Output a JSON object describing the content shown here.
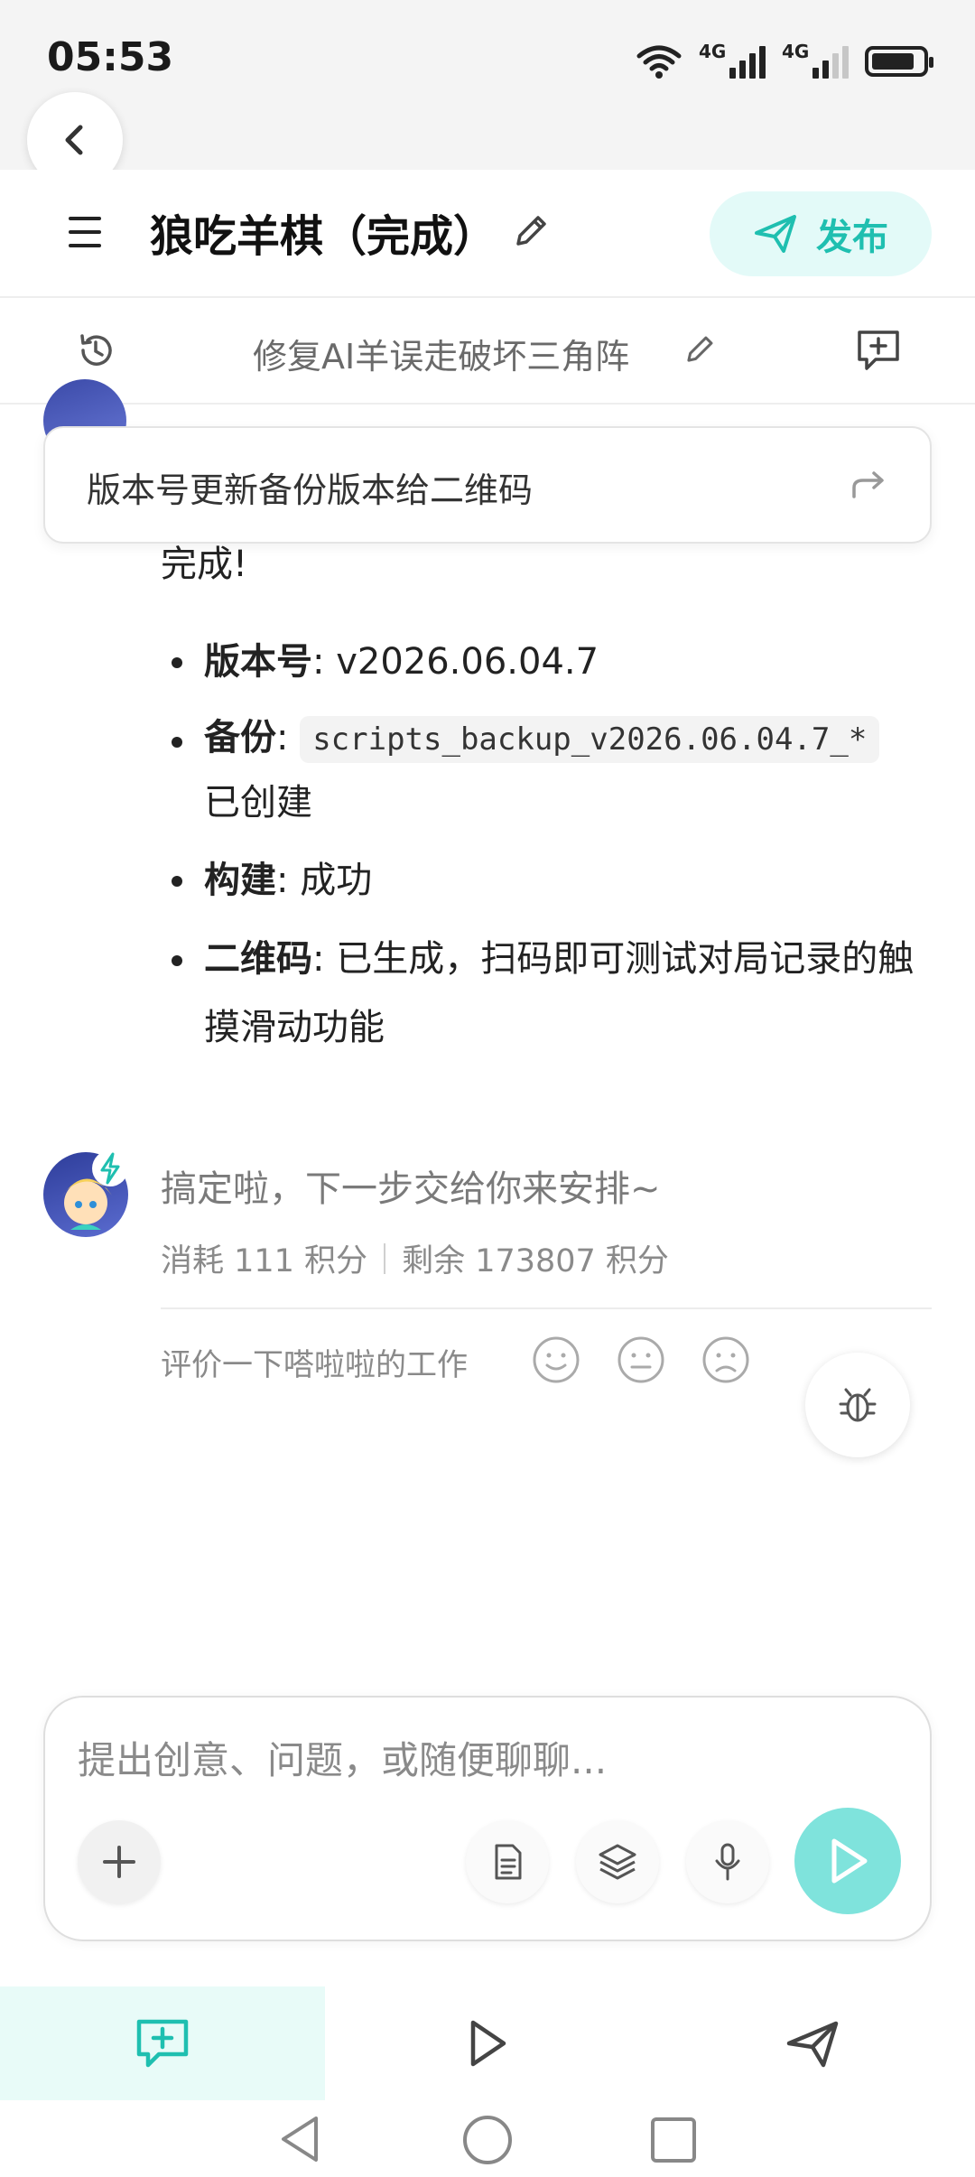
{
  "status": {
    "time": "05:53",
    "network1": "4G",
    "network2": "4G"
  },
  "header": {
    "title": "狼吃羊棋（完成）",
    "publish_label": "发布"
  },
  "subheader": {
    "title": "修复AI羊误走破坏三角阵"
  },
  "floating_card": {
    "text": "版本号更新备份版本给二维码"
  },
  "message": {
    "done": "完成!",
    "bullets": [
      {
        "key": "版本号",
        "value": ": v2026.06.04.7"
      },
      {
        "key": "备份",
        "sep": ": ",
        "code": "scripts_backup_v2026.06.04.7_*",
        "tail": "已创建"
      },
      {
        "key": "构建",
        "value": ": 成功"
      },
      {
        "key": "二维码",
        "value": ": 已生成，扫码即可测试对局记录的触摸滑动功能"
      }
    ]
  },
  "reply": {
    "text": "搞定啦，下一步交给你来安排~",
    "cost": "消耗 111 积分",
    "remaining": "剩余 173807 积分",
    "rate_label": "评价一下嗒啦啦的工作"
  },
  "input": {
    "placeholder": "提出创意、问题，或随便聊聊..."
  },
  "colors": {
    "accent": "#1fbfb0",
    "accent_light": "#e3faf8",
    "send": "#7fe3dc"
  },
  "icons": [
    "back-icon",
    "menu-icon",
    "pencil-icon",
    "send-plane-icon",
    "history-icon",
    "add-comment-icon",
    "share-arrow-icon",
    "smile-icon",
    "neutral-face-icon",
    "sad-face-icon",
    "bug-icon",
    "plus-icon",
    "document-icon",
    "layers-icon",
    "microphone-icon",
    "play-icon"
  ]
}
